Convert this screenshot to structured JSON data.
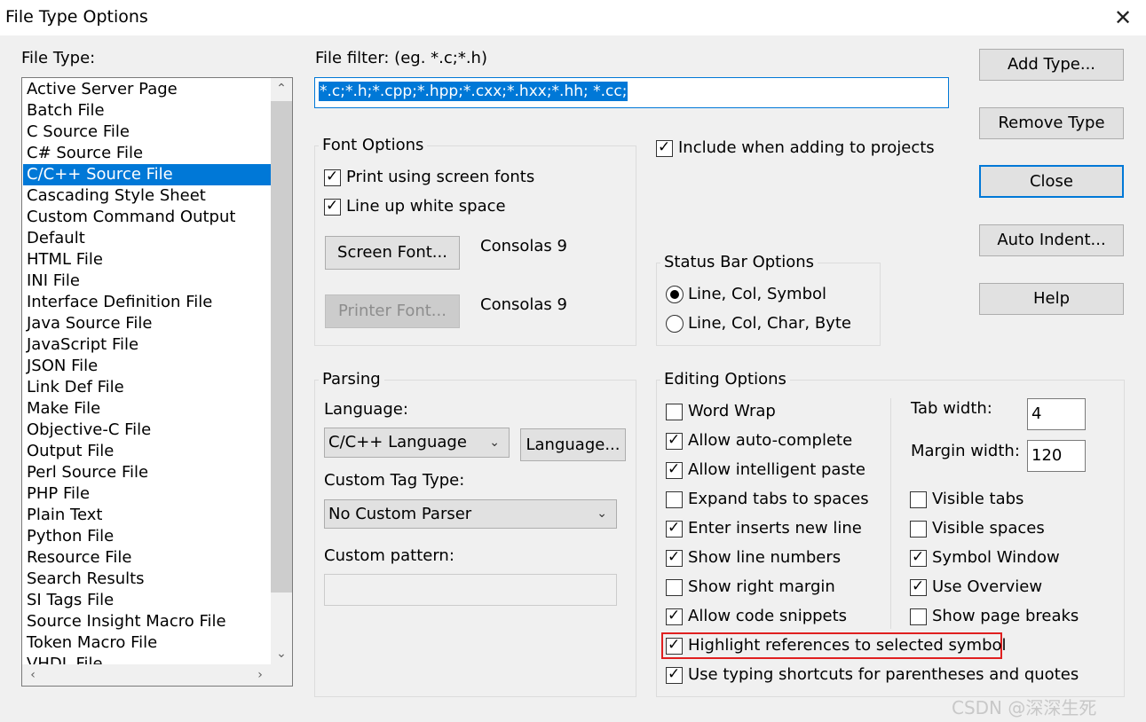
{
  "window": {
    "title": "File Type Options",
    "close_glyph": "✕"
  },
  "file_type": {
    "label": "File Type:",
    "items": [
      "Active Server Page",
      "Batch File",
      "C Source File",
      "C# Source File",
      "C/C++ Source File",
      "Cascading Style Sheet",
      "Custom Command Output",
      "Default",
      "HTML File",
      "INI File",
      "Interface Definition File",
      "Java Source File",
      "JavaScript File",
      "JSON File",
      "Link Def File",
      "Make File",
      "Objective-C File",
      "Output File",
      "Perl Source File",
      "PHP File",
      "Plain Text",
      "Python File",
      "Resource File",
      "Search Results",
      "SI Tags File",
      "Source Insight Macro File",
      "Token Macro File",
      "VHDL File"
    ],
    "selected": "C/C++ Source File",
    "scroll_glyphs": {
      "up": "⌃",
      "down": "⌄",
      "left": "‹",
      "right": "›"
    }
  },
  "file_filter": {
    "label": "File filter: (eg. *.c;*.h)",
    "value": "*.c;*.h;*.cpp;*.hpp;*.cxx;*.hxx;*.hh;  *.cc;"
  },
  "font_options": {
    "title": "Font Options",
    "print_screen_fonts": {
      "label": "Print using screen fonts",
      "checked": true
    },
    "line_up_white_space": {
      "label": "Line up white space",
      "checked": true
    },
    "screen_font_button": "Screen Font...",
    "screen_font_value": "Consolas 9",
    "printer_font_button": "Printer Font...",
    "printer_font_value": "Consolas 9"
  },
  "include_projects": {
    "label": "Include when adding to projects",
    "checked": true
  },
  "status_bar": {
    "title": "Status Bar Options",
    "options": [
      {
        "label": "Line, Col, Symbol",
        "selected": true
      },
      {
        "label": "Line, Col, Char, Byte",
        "selected": false
      }
    ]
  },
  "parsing": {
    "title": "Parsing",
    "language_label": "Language:",
    "language_value": "C/C++ Language",
    "language_button": "Language...",
    "custom_tag_label": "Custom Tag Type:",
    "custom_tag_value": "No Custom Parser",
    "custom_pattern_label": "Custom pattern:",
    "custom_pattern_value": ""
  },
  "editing": {
    "title": "Editing Options",
    "left_options": [
      {
        "label": "Word Wrap",
        "checked": false
      },
      {
        "label": "Allow auto-complete",
        "checked": true
      },
      {
        "label": "Allow intelligent paste",
        "checked": true
      },
      {
        "label": "Expand tabs to spaces",
        "checked": false
      },
      {
        "label": "Enter inserts new line",
        "checked": true
      },
      {
        "label": "Show line numbers",
        "checked": true
      },
      {
        "label": "Show right margin",
        "checked": false
      },
      {
        "label": "Allow code snippets",
        "checked": true
      }
    ],
    "right_options": [
      {
        "label": "Visible tabs",
        "checked": false
      },
      {
        "label": "Visible spaces",
        "checked": false
      },
      {
        "label": "Symbol Window",
        "checked": true
      },
      {
        "label": "Use Overview",
        "checked": true
      },
      {
        "label": "Show page breaks",
        "checked": false
      }
    ],
    "tab_width_label": "Tab width:",
    "tab_width_value": "4",
    "margin_width_label": "Margin width:",
    "margin_width_value": "120",
    "highlight_refs": {
      "label": "Highlight references to selected symbol",
      "checked": true
    },
    "typing_shortcuts": {
      "label": "Use typing shortcuts for parentheses and quotes",
      "checked": true
    }
  },
  "buttons": {
    "add_type": "Add Type...",
    "remove_type": "Remove Type",
    "close": "Close",
    "auto_indent": "Auto Indent...",
    "help": "Help"
  },
  "glyphs": {
    "check": "✓",
    "combo_chevron": "⌄"
  },
  "watermark": "CSDN @深深生死"
}
